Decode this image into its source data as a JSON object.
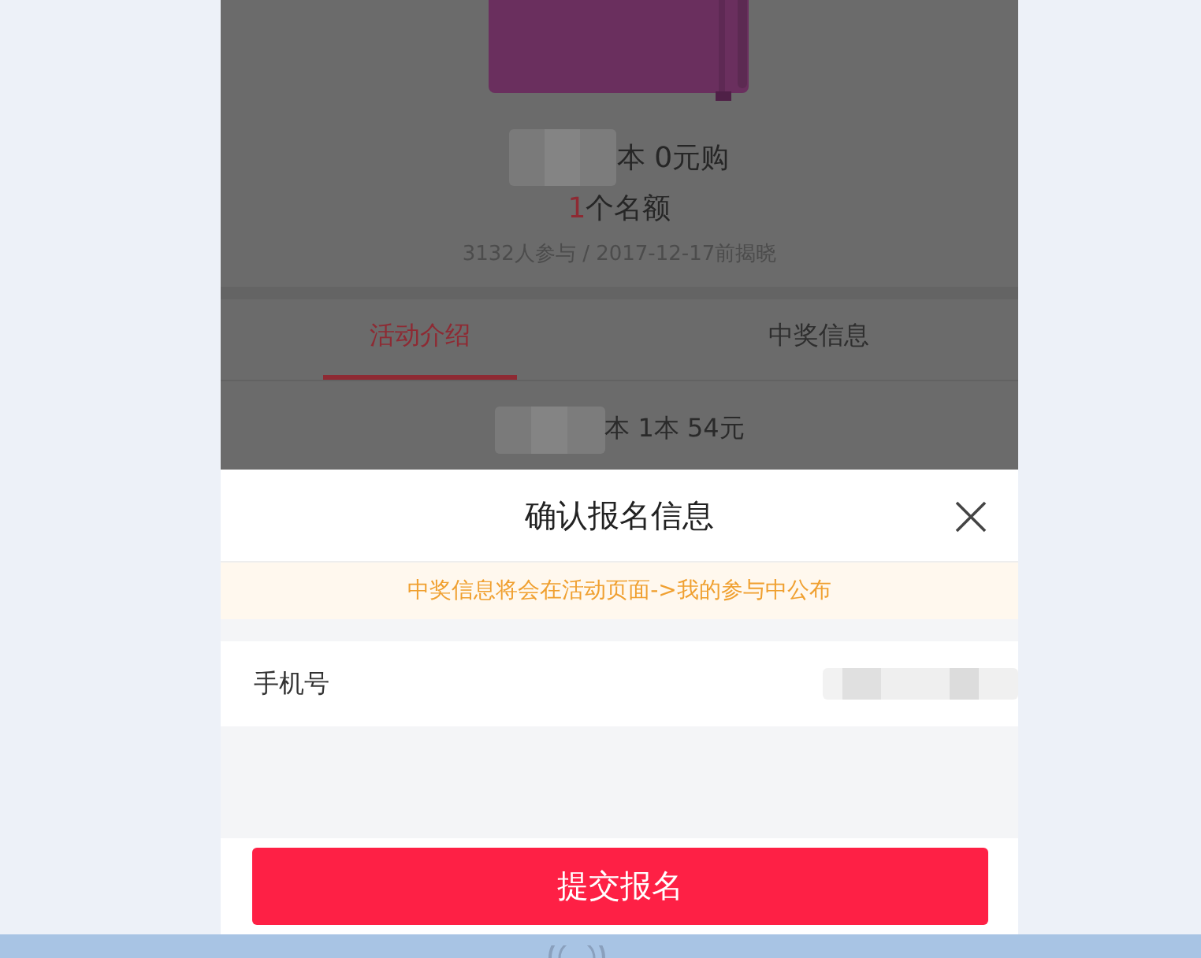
{
  "product": {
    "kind": "picture",
    "title": "本 0元购",
    "quota_count": "1",
    "quota_label": "个名额",
    "meta": "3132人参与 / 2017-12-17前揭晓"
  },
  "tabs": [
    {
      "label": "活动介绍",
      "selected": true
    },
    {
      "label": "中奖信息",
      "selected": false
    }
  ],
  "intro_preview": "本 1本 54元",
  "dialog": {
    "title": "确认报名信息",
    "notice": "中奖信息将会在活动页面->我的参与中公布",
    "fields": [
      {
        "label": "手机号"
      }
    ],
    "submit": "提交报名"
  }
}
